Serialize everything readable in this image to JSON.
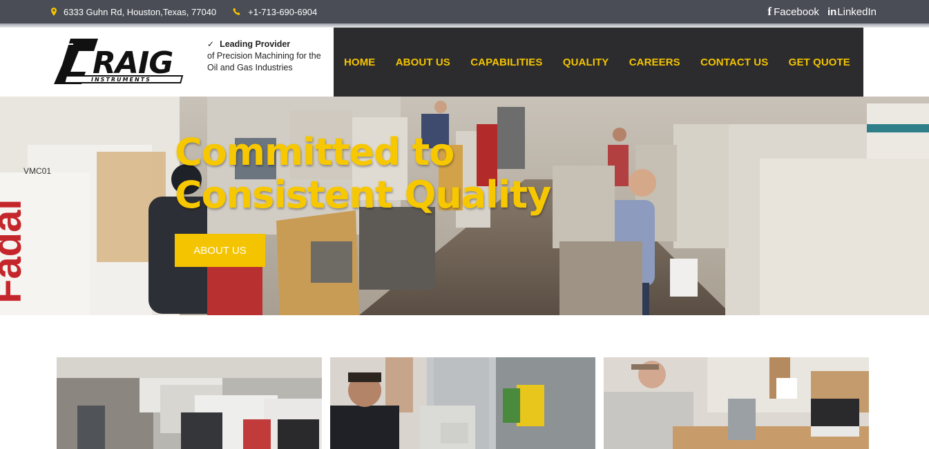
{
  "topbar": {
    "address": "6333 Guhn Rd, Houston,Texas, 77040",
    "phone": "+1-713-690-6904",
    "address_icon": "map-marker-icon",
    "phone_icon": "phone-icon",
    "social": [
      {
        "label": "Facebook",
        "icon": "facebook-icon"
      },
      {
        "label": "LinkedIn",
        "icon": "linkedin-icon"
      }
    ]
  },
  "brand": {
    "logo_text": "RAIG",
    "logo_subtext": "INSTRUMENTS",
    "tagline_heading": "Leading Provider",
    "tagline_line1": "of Precision Machining for the",
    "tagline_line2": "Oil and Gas Industries"
  },
  "nav": {
    "items": [
      "HOME",
      "ABOUT US",
      "CAPABILITIES",
      "QUALITY",
      "CAREERS",
      "CONTACT US",
      "GET QUOTE"
    ]
  },
  "hero": {
    "heading_line1": "Committed to",
    "heading_line2": "Consistent Quality",
    "button_label": "ABOUT US",
    "machine_label": "VMC01",
    "machine_brand": "Fadal"
  },
  "colors": {
    "accent": "#f5c400",
    "nav_bg": "#2c2c2e",
    "topbar_bg": "#4a4d55"
  }
}
